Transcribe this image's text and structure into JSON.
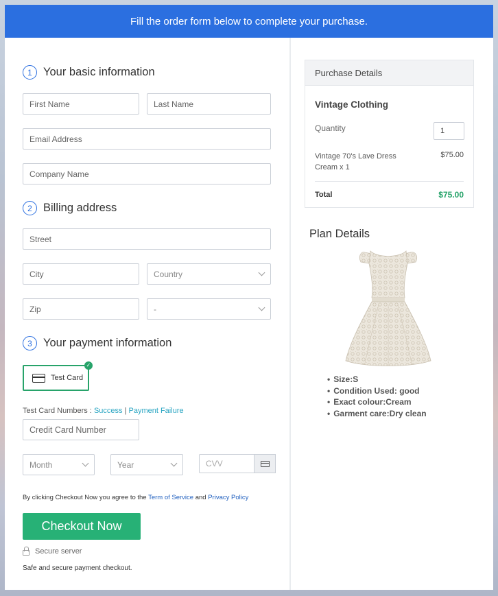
{
  "banner": "Fill the order form below to complete your purchase.",
  "steps": [
    {
      "num": "1",
      "title": "Your basic information"
    },
    {
      "num": "2",
      "title": "Billing address"
    },
    {
      "num": "3",
      "title": "Your payment information"
    }
  ],
  "basic": {
    "first_name_placeholder": "First Name",
    "last_name_placeholder": "Last Name",
    "email_placeholder": "Email Address",
    "company_placeholder": "Company Name"
  },
  "billing": {
    "street_placeholder": "Street",
    "city_placeholder": "City",
    "country_value": "Country",
    "zip_placeholder": "Zip",
    "state_value": "-"
  },
  "payment": {
    "method_label": "Test Card",
    "test_numbers_label": "Test Card Numbers :",
    "success_link": "Success",
    "separator": "|",
    "failure_link": "Payment Failure",
    "card_number_placeholder": "Credit Card Number",
    "month_value": "Month",
    "year_value": "Year",
    "cvv_placeholder": "CVV"
  },
  "terms": {
    "prefix": "By clicking Checkout Now you agree to the",
    "terms_link": "Term of Service",
    "and": "and",
    "privacy_link": "Privacy Policy"
  },
  "checkout_label": "Checkout Now",
  "secure_label": "Secure server",
  "safe_text": "Safe and secure payment checkout.",
  "purchase": {
    "header": "Purchase Details",
    "product_name": "Vintage Clothing",
    "quantity_label": "Quantity",
    "quantity_value": "1",
    "item_line1": "Vintage 70's Lave Dress",
    "item_line2": "Cream x 1",
    "item_price": "$75.00",
    "total_label": "Total",
    "total_value": "$75.00"
  },
  "plan": {
    "title": "Plan Details",
    "features": [
      "Size:S",
      "Condition Used: good",
      "Exact colour:Cream",
      "Garment care:Dry clean"
    ]
  },
  "colors": {
    "banner": "#2b6fe0",
    "accent_green": "#27b176",
    "total_green": "#27a36a",
    "link_teal": "#29a5c2"
  }
}
